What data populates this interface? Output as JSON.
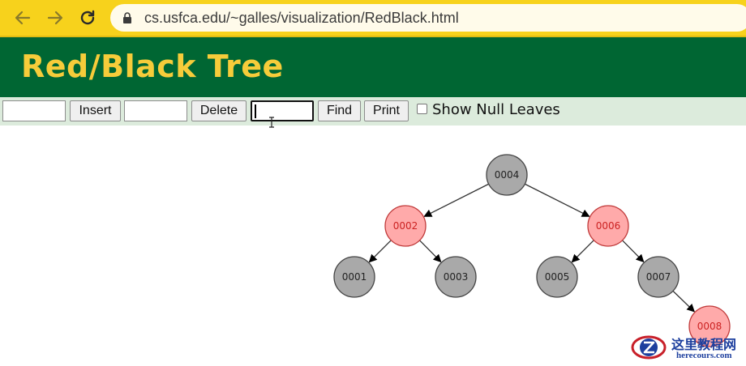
{
  "browser": {
    "url": "cs.usfca.edu/~galles/visualization/RedBlack.html",
    "back_icon": "arrow-left-icon",
    "forward_icon": "arrow-right-icon",
    "reload_icon": "reload-icon",
    "lock_icon": "lock-icon",
    "accent_color": "#f7d21c"
  },
  "header": {
    "title": "Red/Black Tree",
    "background_color": "#006633",
    "title_color": "#f6cc3a"
  },
  "controls": {
    "insert_input_value": "",
    "insert_label": "Insert",
    "delete_input_value": "",
    "delete_label": "Delete",
    "find_input_value": "",
    "find_label": "Find",
    "print_label": "Print",
    "show_null_leaves_label": "Show Null Leaves",
    "show_null_leaves_checked": false
  },
  "tree": {
    "nodes": [
      {
        "key": "0004",
        "color": "black"
      },
      {
        "key": "0002",
        "color": "red"
      },
      {
        "key": "0006",
        "color": "red"
      },
      {
        "key": "0001",
        "color": "black"
      },
      {
        "key": "0003",
        "color": "black"
      },
      {
        "key": "0005",
        "color": "black"
      },
      {
        "key": "0007",
        "color": "black"
      },
      {
        "key": "0008",
        "color": "red"
      }
    ],
    "edges": [
      [
        "0004",
        "0002"
      ],
      [
        "0004",
        "0006"
      ],
      [
        "0002",
        "0001"
      ],
      [
        "0002",
        "0003"
      ],
      [
        "0006",
        "0005"
      ],
      [
        "0006",
        "0007"
      ],
      [
        "0007",
        "0008"
      ]
    ],
    "black_fill": "#a9a9a9",
    "red_fill": "#ffaaaa",
    "red_text": "#cc2222"
  },
  "watermark": {
    "cn_text": "这里教程网",
    "en_text": "herecours.com"
  }
}
